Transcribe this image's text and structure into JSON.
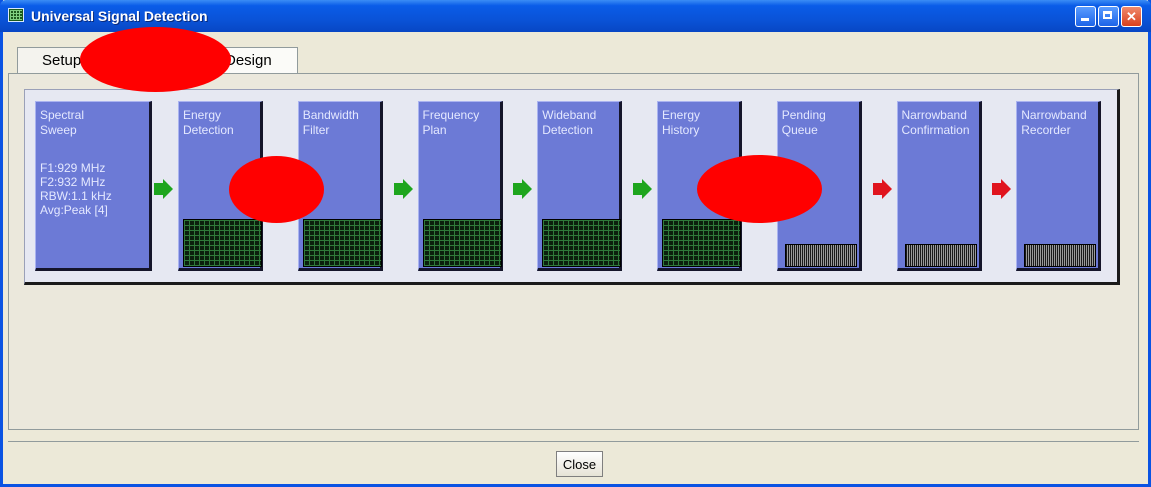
{
  "window": {
    "title": "Universal Signal Detection"
  },
  "tabs": [
    {
      "label": "Setup"
    },
    {
      "label": "Design"
    }
  ],
  "pipeline": {
    "stages": [
      {
        "title": "Spectral\nSweep",
        "params": [
          "F1:929 MHz",
          "F2:932 MHz",
          "RBW:1.1 kHz",
          "Avg:Peak [4]"
        ],
        "indicator": "none"
      },
      {
        "title": "Energy\nDetection",
        "params": [],
        "indicator": "grid"
      },
      {
        "title": "Bandwidth\nFilter",
        "params": [],
        "indicator": "grid"
      },
      {
        "title": "Frequency\nPlan",
        "params": [],
        "indicator": "grid"
      },
      {
        "title": "Wideband\nDetection",
        "params": [],
        "indicator": "grid"
      },
      {
        "title": "Energy\nHistory",
        "params": [],
        "indicator": "grid"
      },
      {
        "title": "Pending\nQueue",
        "params": [],
        "indicator": "queue"
      },
      {
        "title": "Narrowband\nConfirmation",
        "params": [],
        "indicator": "queue"
      },
      {
        "title": "Narrowband\nRecorder",
        "params": [],
        "indicator": "queue"
      }
    ],
    "arrows": [
      "green",
      "green",
      "green",
      "green",
      "green",
      "red",
      "red",
      "red"
    ]
  },
  "footer": {
    "close_label": "Close"
  },
  "colors": {
    "stage_fill": "#6c7ad6",
    "arrow_ok": "#1ea51e",
    "arrow_pending": "#e0141e",
    "redaction": "#ff0000"
  }
}
